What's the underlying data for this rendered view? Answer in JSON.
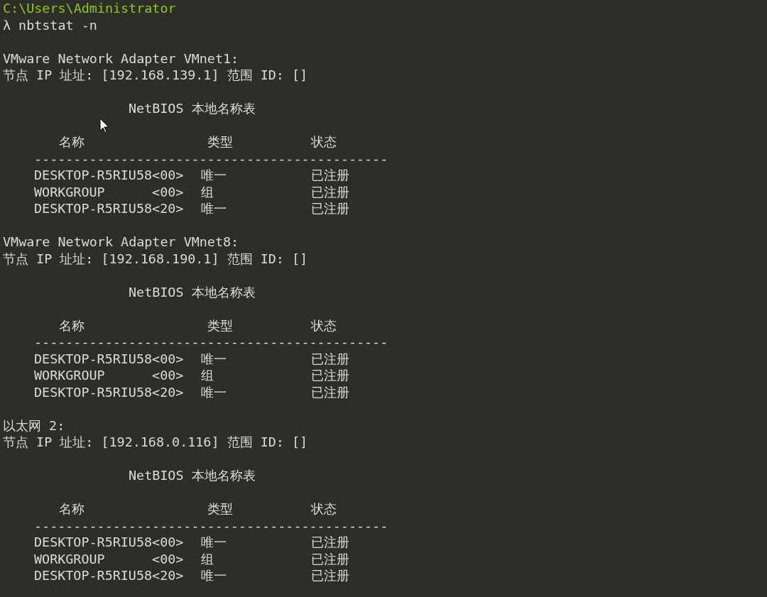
{
  "terminal": {
    "path": "C:\\Users\\Administrator",
    "prompt_symbol": "λ",
    "command": "nbtstat -n",
    "adapters": [
      {
        "name": "VMware Network Adapter VMnet1:",
        "ip_line": "节点 IP 址址: [192.168.139.1] 范围 ID: []",
        "table_title": "NetBIOS 本地名称表",
        "columns": [
          "名称",
          "类型",
          "状态"
        ],
        "separator": "---------------------------------------------",
        "rows": [
          {
            "name": "DESKTOP-R5RIU58<00>",
            "type": "唯一",
            "status": "已注册"
          },
          {
            "name": "WORKGROUP      <00>",
            "type": "组",
            "status": "已注册"
          },
          {
            "name": "DESKTOP-R5RIU58<20>",
            "type": "唯一",
            "status": "已注册"
          }
        ]
      },
      {
        "name": "VMware Network Adapter VMnet8:",
        "ip_line": "节点 IP 址址: [192.168.190.1] 范围 ID: []",
        "table_title": "NetBIOS 本地名称表",
        "columns": [
          "名称",
          "类型",
          "状态"
        ],
        "separator": "---------------------------------------------",
        "rows": [
          {
            "name": "DESKTOP-R5RIU58<00>",
            "type": "唯一",
            "status": "已注册"
          },
          {
            "name": "WORKGROUP      <00>",
            "type": "组",
            "status": "已注册"
          },
          {
            "name": "DESKTOP-R5RIU58<20>",
            "type": "唯一",
            "status": "已注册"
          }
        ]
      },
      {
        "name": "以太网 2:",
        "ip_line": "节点 IP 址址: [192.168.0.116] 范围 ID: []",
        "table_title": "NetBIOS 本地名称表",
        "columns": [
          "名称",
          "类型",
          "状态"
        ],
        "separator": "---------------------------------------------",
        "rows": [
          {
            "name": "DESKTOP-R5RIU58<00>",
            "type": "唯一",
            "status": "已注册"
          },
          {
            "name": "WORKGROUP      <00>",
            "type": "组",
            "status": "已注册"
          },
          {
            "name": "DESKTOP-R5RIU58<20>",
            "type": "唯一",
            "status": "已注册"
          }
        ]
      }
    ]
  }
}
